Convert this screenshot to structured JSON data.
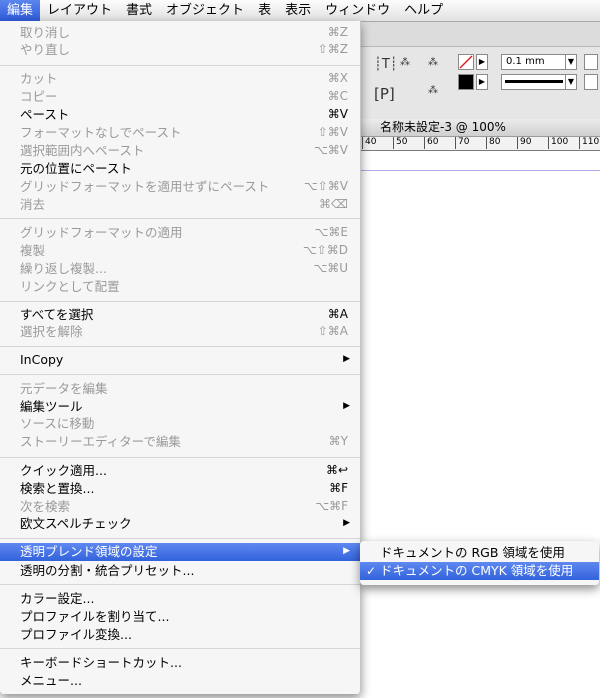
{
  "menubar": {
    "items": [
      "編集",
      "レイアウト",
      "書式",
      "オブジェクト",
      "表",
      "表示",
      "ウィンドウ",
      "ヘルプ"
    ]
  },
  "document": {
    "title": "名称未設定-3 @ 100%",
    "stroke_weight": "0.1 mm",
    "ruler_labels": [
      "40",
      "50",
      "60",
      "70",
      "80",
      "90",
      "100",
      "110"
    ]
  },
  "menu": {
    "undo": {
      "label": "取り消し",
      "shortcut": "⌘Z"
    },
    "redo": {
      "label": "やり直し",
      "shortcut": "⇧⌘Z"
    },
    "cut": {
      "label": "カット",
      "shortcut": "⌘X"
    },
    "copy": {
      "label": "コピー",
      "shortcut": "⌘C"
    },
    "paste": {
      "label": "ペースト",
      "shortcut": "⌘V"
    },
    "paste_no_format": {
      "label": "フォーマットなしでペースト",
      "shortcut": "⇧⌘V"
    },
    "paste_into": {
      "label": "選択範囲内へペースト",
      "shortcut": "⌥⌘V"
    },
    "paste_in_place": {
      "label": "元の位置にペースト",
      "shortcut": ""
    },
    "paste_no_grid": {
      "label": "グリッドフォーマットを適用せずにペースト",
      "shortcut": "⌥⇧⌘V"
    },
    "clear": {
      "label": "消去",
      "shortcut": "⌘⌫"
    },
    "apply_grid": {
      "label": "グリッドフォーマットの適用",
      "shortcut": "⌥⌘E"
    },
    "duplicate": {
      "label": "複製",
      "shortcut": "⌥⇧⌘D"
    },
    "step_repeat": {
      "label": "繰り返し複製...",
      "shortcut": "⌥⌘U"
    },
    "place_linked": {
      "label": "リンクとして配置",
      "shortcut": ""
    },
    "select_all": {
      "label": "すべてを選択",
      "shortcut": "⌘A"
    },
    "deselect_all": {
      "label": "選択を解除",
      "shortcut": "⇧⌘A"
    },
    "incopy": {
      "label": "InCopy",
      "shortcut": ""
    },
    "edit_original": {
      "label": "元データを編集",
      "shortcut": ""
    },
    "edit_with": {
      "label": "編集ツール",
      "shortcut": ""
    },
    "go_to_source": {
      "label": "ソースに移動",
      "shortcut": ""
    },
    "story_editor": {
      "label": "ストーリーエディターで編集",
      "shortcut": "⌘Y"
    },
    "quick_apply": {
      "label": "クイック適用...",
      "shortcut": "⌘↩"
    },
    "find_replace": {
      "label": "検索と置換...",
      "shortcut": "⌘F"
    },
    "find_next": {
      "label": "次を検索",
      "shortcut": "⌥⌘F"
    },
    "spelling": {
      "label": "欧文スペルチェック",
      "shortcut": ""
    },
    "transparency_blend_space": {
      "label": "透明ブレンド領域の設定",
      "shortcut": ""
    },
    "transparency_flattener": {
      "label": "透明の分割・統合プリセット...",
      "shortcut": ""
    },
    "color_settings": {
      "label": "カラー設定...",
      "shortcut": ""
    },
    "assign_profiles": {
      "label": "プロファイルを割り当て...",
      "shortcut": ""
    },
    "convert_profile": {
      "label": "プロファイル変換...",
      "shortcut": ""
    },
    "keyboard_shortcuts": {
      "label": "キーボードショートカット...",
      "shortcut": ""
    },
    "menus": {
      "label": "メニュー...",
      "shortcut": ""
    }
  },
  "submenu": {
    "rgb": {
      "label": "ドキュメントの RGB 領域を使用",
      "checked": false
    },
    "cmyk": {
      "label": "ドキュメントの CMYK 領域を使用",
      "checked": true
    },
    "check_glyph": "✓"
  },
  "arrow_glyph": "▶",
  "colors": {
    "highlight": "#3263dc",
    "disabled_text": "#9a9a9a"
  }
}
